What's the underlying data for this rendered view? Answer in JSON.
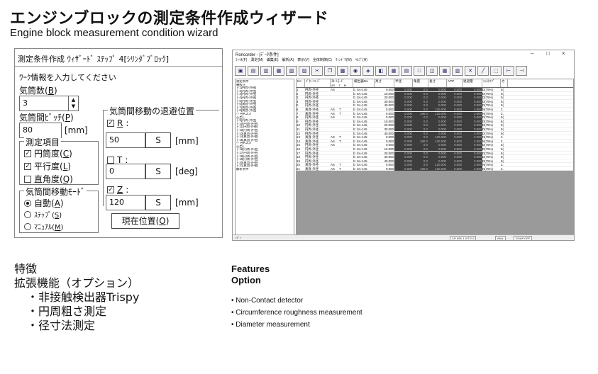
{
  "page": {
    "title": "エンジンブロックの測定条件作成ウィザード",
    "subtitle": "Engine block measurement condition wizard"
  },
  "dialog": {
    "title": "測定条件作成 ｳｨｻﾞｰﾄﾞ ｽﾃｯﾌﾟ 4[ｼﾘﾝﾀﾞﾌﾞﾛｯｸ]",
    "prompt": "ﾜｰｸ情報を入力してください",
    "cyl_count_label": "気筒数",
    "cyl_count_key": "B",
    "cyl_count_value": "3",
    "cyl_pitch_label": "気筒間ﾋﾟｯﾁ",
    "cyl_pitch_key": "P",
    "cyl_pitch_value": "80",
    "cyl_pitch_unit": "[mm]",
    "measure_group": "測定項目",
    "measure_items": [
      {
        "label": "円筒度",
        "key": "C",
        "checked": true
      },
      {
        "label": "平行度",
        "key": "L",
        "checked": true
      },
      {
        "label": "直角度",
        "key": "Q",
        "checked": false
      }
    ],
    "move_mode_group": "気筒間移動ﾓｰﾄﾞ",
    "move_modes": [
      {
        "label": "自動",
        "key": "A",
        "selected": true
      },
      {
        "label": "ｽﾃｯﾌﾟ",
        "key": "S",
        "selected": false
      },
      {
        "label": "ﾏﾆｭｱﾙ",
        "key": "M",
        "selected": false
      }
    ],
    "retreat_group": "気筒間移動の退避位置",
    "retreat": [
      {
        "axis": "R",
        "checked": true,
        "value": "50",
        "btn": "S",
        "unit": "[mm]"
      },
      {
        "axis": "T",
        "checked": false,
        "value": "0",
        "btn": "S",
        "unit": "[deg]"
      },
      {
        "axis": "Z",
        "checked": true,
        "value": "120",
        "btn": "S",
        "unit": "[mm]"
      }
    ],
    "current_pos_btn": "現在位置",
    "current_pos_key": "O"
  },
  "app": {
    "title": "Roncorder - [ﾃﾞｰﾀ条件]",
    "win_controls": [
      "–",
      "□",
      "×"
    ],
    "menu": [
      "ﾌｧｲﾙ(F)",
      "測定(M)",
      "編集(E)",
      "解析(A)",
      "表示(V)",
      "全体制御(C)",
      "ｳｨﾝﾄﾞｳ(W)",
      "ﾍﾙﾌﾟ(H)"
    ],
    "tree": [
      "測定条件",
      "軸校正",
      "├ 1[円周-外径]",
      "├ 2[円周-外径]",
      "├ 3[円周-外径]",
      "├ 4[円周-外径]",
      "├ 5[円周-外径]",
      "├ 6[真直-外径]",
      "├ 7[真直-外径]",
      "├ 8[真直-外径]",
      "-:- 径R,Z,X",
      "芯出し",
      "├ 9[円周-外径]",
      "├ 10[円周-外径]",
      "├ 11[円周-外径]",
      "├ 12[円周-外径]",
      "├ 13[真直-外径]",
      "├ 14[真直-外径]",
      "├ 15[真直-外径]",
      "-:- 径R,Z,X",
      "芯出し",
      "├ 16[円周-外径]",
      "├ 17[円周-外径]",
      "├ 18[円周-外径]",
      "├ 19[円周-外径]",
      "├ 20[真直-外径]",
      "├ 21[真直-外径]",
      "解析条件"
    ],
    "columns": [
      "No",
      "ﾊﾟﾀｰﾝｺｰﾄﾞ",
      "ｽﾀｰﾄﾓｰﾄﾞ",
      "検出器No",
      "高さ",
      "半径",
      "角度",
      "長さ",
      "APP",
      "退避量",
      "ﾌｨﾙﾀｲﾌﾟ",
      "カ"
    ],
    "sub_columns": [
      "AS",
      "T",
      "M"
    ],
    "rows": [
      [
        "1",
        "円周-外径",
        "AS",
        "",
        "b: SA-145",
        "0.000",
        "0.000",
        "0.0",
        "0.000",
        "0.000",
        "0.000",
        "D(75%)",
        "5("
      ],
      [
        "2",
        "円周-外径",
        "",
        "",
        "b: SA-145",
        "10.000",
        "0.000",
        "0.0",
        "0.000",
        "0.000",
        "0.000",
        "D(75%)",
        "5("
      ],
      [
        "3",
        "円周-外径",
        "",
        "",
        "b: SA-145",
        "20.000",
        "0.000",
        "0.0",
        "0.000",
        "0.000",
        "0.000",
        "D(75%)",
        "5("
      ],
      [
        "4",
        "円周-外径",
        "",
        "",
        "b: SA-145",
        "30.000",
        "0.000",
        "0.0",
        "0.000",
        "0.000",
        "0.000",
        "D(75%)",
        "5("
      ],
      [
        "5",
        "円周-外径",
        "",
        "",
        "b: SA-145",
        "40.000",
        "0.000",
        "0.0",
        "0.000",
        "0.000",
        "0.000",
        "D(75%)",
        "5("
      ],
      [
        "6",
        "真直-外径",
        "AS",
        "T",
        "b: SA-145",
        "0.000",
        "0.000",
        "0.0",
        "120.000",
        "0.000",
        "3.000",
        "N(75%)",
        "2."
      ],
      [
        "7",
        "真直-外径",
        "AS",
        "T",
        "b: SA-145",
        "0.000",
        "0.000",
        "180.0",
        "120.000",
        "0.000",
        "3.000",
        "N(75%)",
        "2."
      ],
      [
        "8",
        "円周-外径",
        "AS",
        "",
        "b: SA-145",
        "0.000",
        "0.000",
        "0.0",
        "0.000",
        "0.000",
        "0.000",
        "D(75%)",
        "5("
      ],
      [
        "9",
        "円周-外径",
        "",
        "",
        "b: SA-145",
        "10.000",
        "0.000",
        "0.0",
        "0.000",
        "0.000",
        "0.000",
        "D(75%)",
        "5("
      ],
      [
        "10",
        "円周-外径",
        "",
        "",
        "b: SA-145",
        "20.000",
        "0.000",
        "0.0",
        "0.000",
        "0.000",
        "0.000",
        "D(75%)",
        "5("
      ],
      [
        "11",
        "円周-外径",
        "",
        "",
        "b: SA-145",
        "30.000",
        "0.000",
        "0.0",
        "0.000",
        "0.000",
        "0.000",
        "D(75%)",
        "5("
      ],
      [
        "12",
        "円周-外径",
        "",
        "",
        "b: SA-145",
        "40.000",
        "0.000",
        "0.0",
        "0.000",
        "0.000",
        "3.000",
        "D(75%)",
        "5("
      ],
      [
        "13",
        "真直-外径",
        "AS",
        "T",
        "b: SA-145",
        "0.000",
        "0.000",
        "0.0",
        "120.000",
        "0.000",
        "3.000",
        "N(75%)",
        "2."
      ],
      [
        "14",
        "真直-外径",
        "AS",
        "T",
        "b: SA-145",
        "0.000",
        "0.000",
        "180.0",
        "120.000",
        "0.000",
        "3.000",
        "N(75%)",
        "2."
      ],
      [
        "15",
        "円周-外径",
        "AS",
        "",
        "b: SA-145",
        "0.000",
        "0.000",
        "0.0",
        "0.000",
        "0.000",
        "0.000",
        "D(75%)",
        "5("
      ],
      [
        "16",
        "円周-外径",
        "",
        "",
        "b: SA-145",
        "10.000",
        "0.000",
        "0.0",
        "0.000",
        "0.000",
        "0.000",
        "D(75%)",
        "5("
      ],
      [
        "17",
        "円周-外径",
        "",
        "",
        "b: SA-145",
        "20.000",
        "0.000",
        "0.0",
        "0.000",
        "0.000",
        "0.000",
        "D(75%)",
        "5("
      ],
      [
        "18",
        "円周-外径",
        "",
        "",
        "b: SA-145",
        "30.000",
        "0.000",
        "0.0",
        "0.000",
        "0.000",
        "0.000",
        "D(75%)",
        "5("
      ],
      [
        "19",
        "円周-外径",
        "",
        "",
        "b: SA-145",
        "40.000",
        "0.000",
        "0.0",
        "0.000",
        "0.000",
        "3.000",
        "D(75%)",
        "5("
      ],
      [
        "20",
        "真直-外径",
        "AS",
        "T",
        "b: SA-145",
        "0.000",
        "0.000",
        "0.0",
        "120.000",
        "0.000",
        "3.000",
        "N(75%)",
        "2."
      ],
      [
        "21",
        "真直-外径",
        "AS",
        "T",
        "b: SA-145",
        "0.000",
        "0.000",
        "180.0",
        "120.000",
        "0.000",
        "3.000",
        "N(75%)",
        "2."
      ]
    ],
    "status": [
      "ﾚﾃﾞｨ",
      "Z/0.0/R/-1.0/T/2.0",
      "ANA:",
      "SOAP:OFF"
    ]
  },
  "features_jp": {
    "title": "特徴",
    "subtitle": "拡張機能（オプション）",
    "items": [
      "・非接触検出器Trispy",
      "・円周粗さ測定",
      "・径寸法測定"
    ]
  },
  "features_en": {
    "title": "Features",
    "subtitle": "Option",
    "items": [
      "• Non-Contact detector",
      "• Circumference roughness measurement",
      "• Diameter measurement"
    ]
  }
}
